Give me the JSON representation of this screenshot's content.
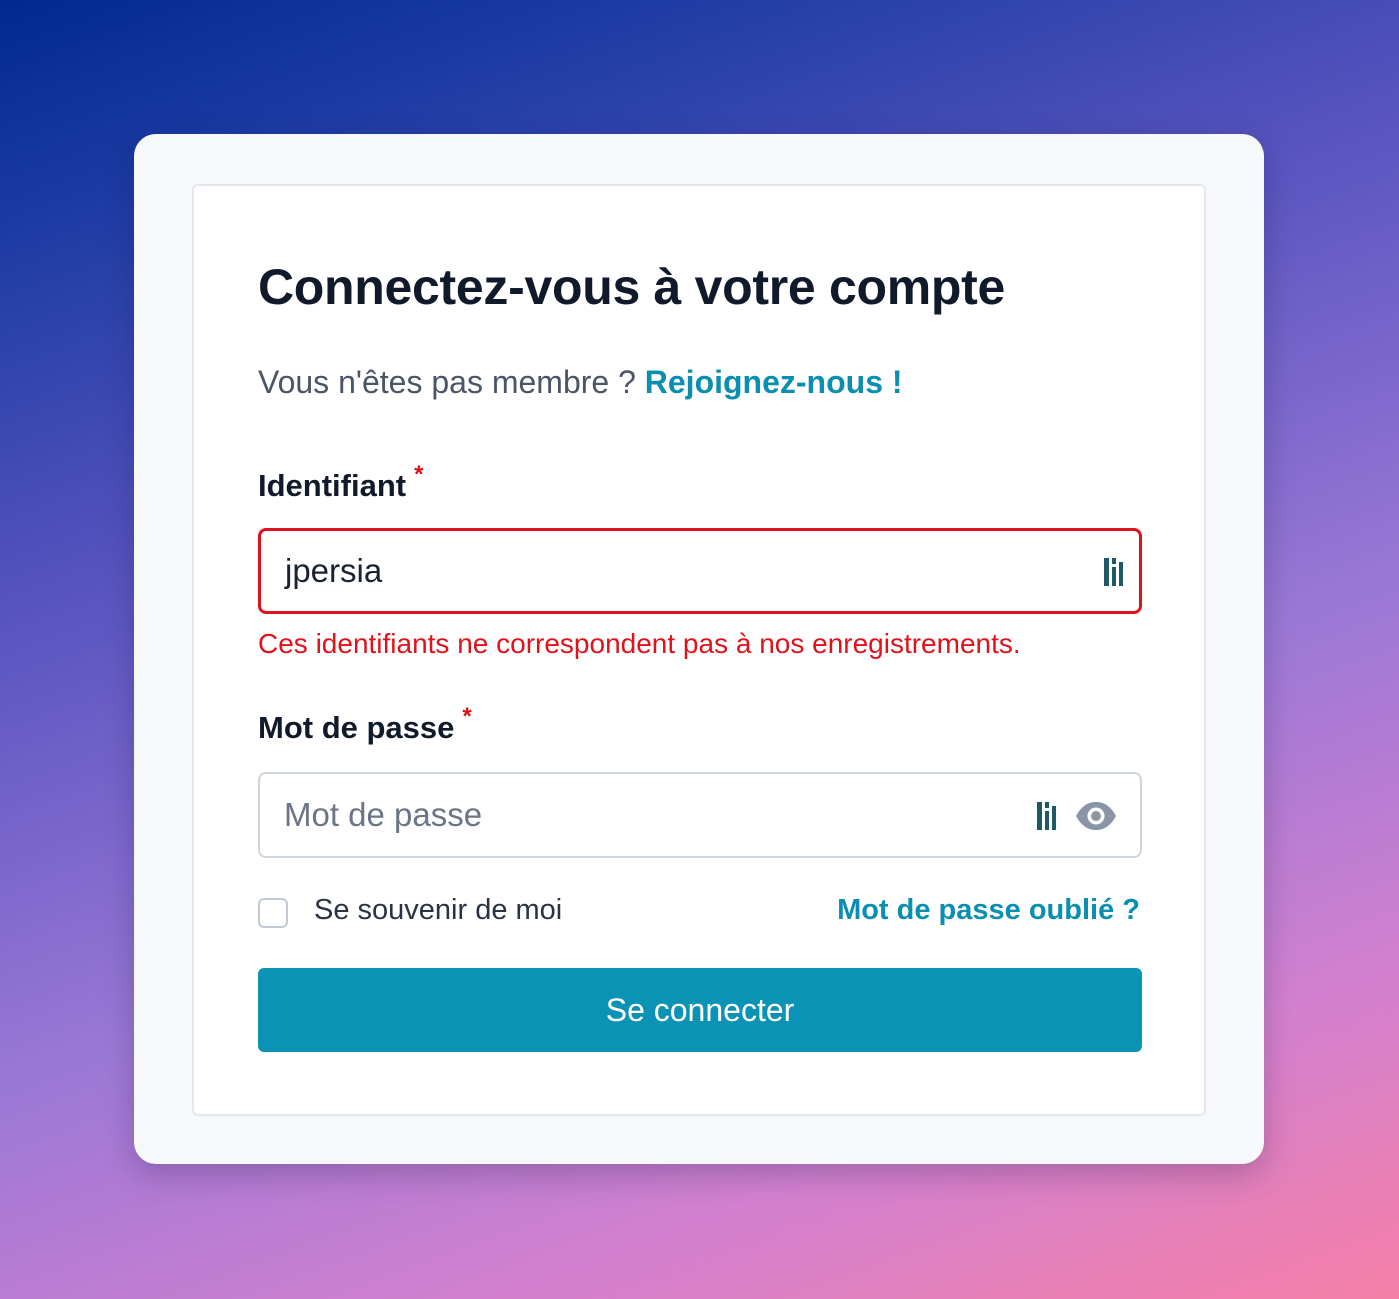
{
  "login": {
    "title": "Connectez-vous à votre compte",
    "signup_prompt": "Vous n'êtes pas membre ?",
    "signup_link": "Rejoignez-nous !",
    "username": {
      "label": "Identifiant",
      "required_mark": "*",
      "value": "jpersia",
      "error": "Ces identifiants ne correspondent pas à nos enregistrements."
    },
    "password": {
      "label": "Mot de passe",
      "required_mark": "*",
      "placeholder": "Mot de passe",
      "value": ""
    },
    "remember_label": "Se souvenir de moi",
    "remember_checked": false,
    "forgot_link": "Mot de passe oublié ?",
    "submit_label": "Se connecter"
  },
  "icons": {
    "password_manager": "password-manager-icon",
    "reveal_password": "eye-icon"
  },
  "colors": {
    "accent": "#0a93b4",
    "link": "#0a8fb0",
    "error": "#e0121b",
    "title": "#111a2b"
  }
}
